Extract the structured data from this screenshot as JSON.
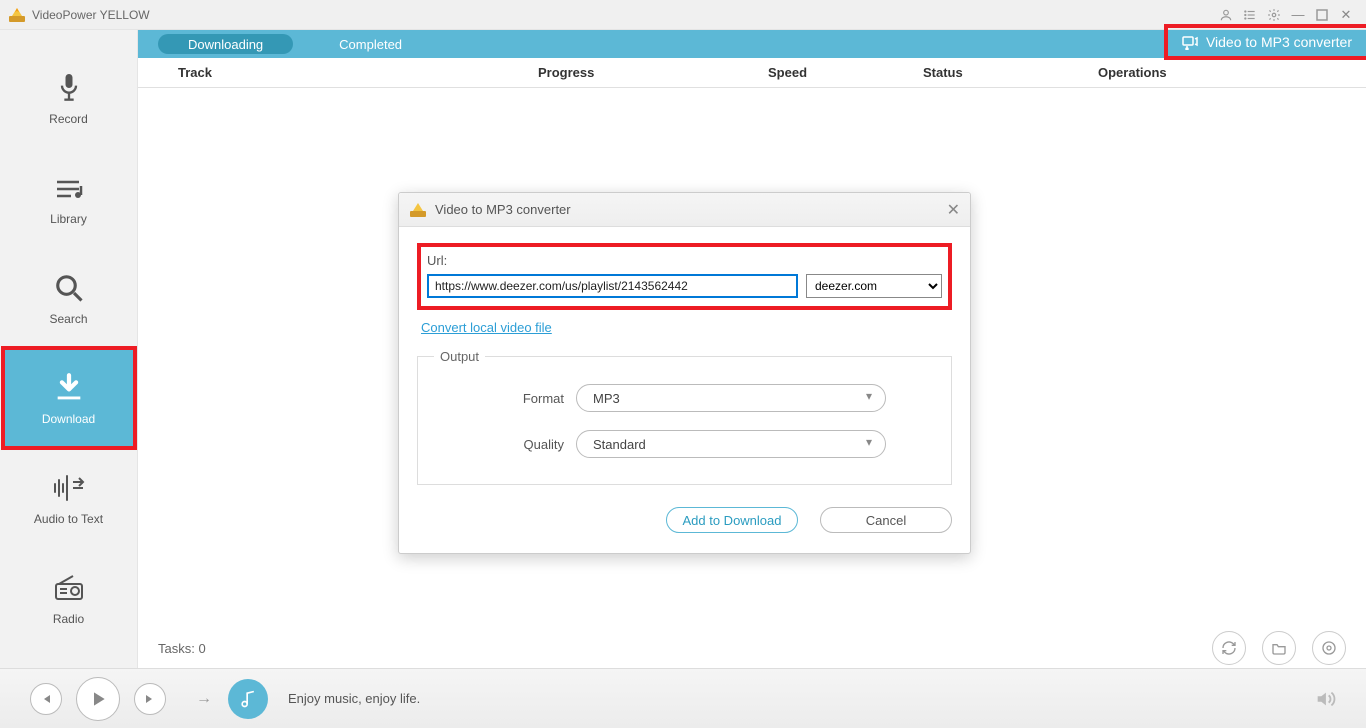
{
  "app_title": "VideoPower YELLOW",
  "sidebar": {
    "items": [
      {
        "label": "Record",
        "icon": "mic"
      },
      {
        "label": "Library",
        "icon": "library"
      },
      {
        "label": "Search",
        "icon": "search"
      },
      {
        "label": "Download",
        "icon": "download"
      },
      {
        "label": "Audio to Text",
        "icon": "audiotext"
      },
      {
        "label": "Radio",
        "icon": "radio"
      }
    ],
    "active_index": 3
  },
  "tabs": {
    "items": [
      "Downloading",
      "Completed"
    ],
    "active_index": 0,
    "converter_label": "Video to MP3 converter"
  },
  "columns": {
    "track": "Track",
    "progress": "Progress",
    "speed": "Speed",
    "status": "Status",
    "operations": "Operations"
  },
  "tasks_label": "Tasks: 0",
  "player": {
    "tagline": "Enjoy music, enjoy life."
  },
  "dialog": {
    "title": "Video to MP3 converter",
    "url_label": "Url:",
    "url_value": "https://www.deezer.com/us/playlist/2143562442",
    "site_value": "deezer.com",
    "convert_local_label": "Convert local video file",
    "output_legend": "Output",
    "format_label": "Format",
    "format_value": "MP3",
    "quality_label": "Quality",
    "quality_value": "Standard",
    "add_button": "Add to Download",
    "cancel_button": "Cancel"
  }
}
